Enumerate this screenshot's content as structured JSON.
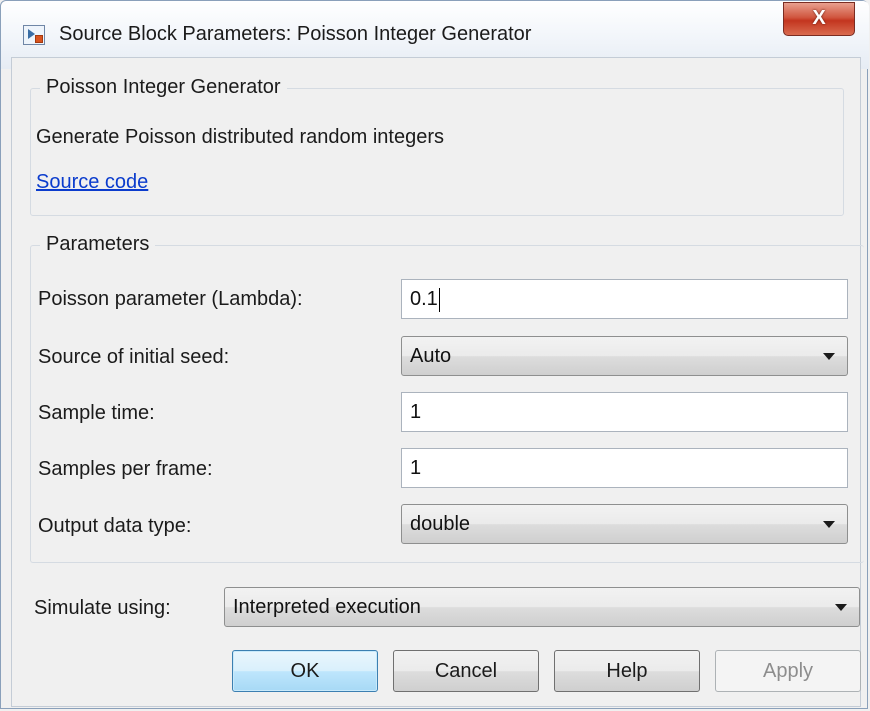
{
  "window": {
    "title": "Source Block Parameters: Poisson Integer Generator",
    "close_label": "X"
  },
  "description_group": {
    "label": "Poisson Integer Generator",
    "description": "Generate Poisson distributed random integers",
    "link": "Source code"
  },
  "parameters_group": {
    "label": "Parameters",
    "lambda": {
      "label": "Poisson parameter (Lambda):",
      "value": "0.1"
    },
    "seed": {
      "label": "Source of initial seed:",
      "value": "Auto"
    },
    "sample_time": {
      "label": "Sample time:",
      "value": "1"
    },
    "samples_per_frame": {
      "label": "Samples per frame:",
      "value": "1"
    },
    "output_type": {
      "label": "Output data type:",
      "value": "double"
    }
  },
  "simulate": {
    "label": "Simulate using:",
    "value": "Interpreted execution"
  },
  "buttons": {
    "ok": "OK",
    "cancel": "Cancel",
    "help": "Help",
    "apply": "Apply"
  }
}
